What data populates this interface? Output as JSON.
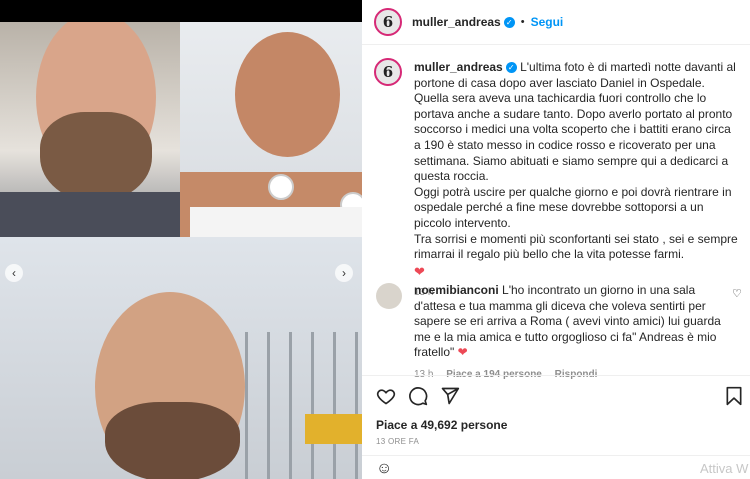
{
  "post": {
    "username": "muller_andreas",
    "follow_label": "Segui",
    "dot": "•",
    "caption_lines": [
      "L'ultima foto è di martedì notte davanti al portone di casa dopo aver lasciato Daniel in Ospedale. Quella sera aveva una tachicardia fuori controllo che lo portava anche a sudare tanto. Dopo averlo portato al pronto soccorso i medici una volta scoperto che i battiti erano circa a 190 è stato messo in codice rosso e ricoverato per una settimana. Siamo abituati e siamo sempre qui a dedicarci a questa roccia.",
      "Oggi potrà uscire per qualche giorno e poi dovrà rientrare in ospedale perché a fine mese dovrebbe sottoporsi a un piccolo intervento.",
      "Tra sorrisi e momenti più sconfortanti sei stato , sei e sempre rimarrai il regalo più bello che la vita potesse farmi."
    ],
    "caption_time": "13 h",
    "likes": "Piace a 49,692 persone",
    "posted_ago": "13 ORE FA"
  },
  "comment": {
    "username": "noemibianconi",
    "text": "L'ho incontrato un giorno in una sala d'attesa e tua mamma gli diceva che voleva sentirti per sapere se eri arriva a Roma ( avevi vinto amici) lui guarda me e la mia amica e tutto orgoglioso ci fa\" Andreas è mio fratello\"",
    "time": "13 h",
    "likes": "Piace a 194 persone",
    "reply_label": "Rispondi"
  },
  "icons": {
    "heart_emoji": "red-heart",
    "like": "heart-outline-icon",
    "comment": "comment-icon",
    "share": "paper-plane-icon",
    "save": "bookmark-icon"
  },
  "photo": {
    "avatar_letter": "6",
    "carousel_dots": 8,
    "active_dot": 7
  },
  "system": {
    "watermark": "Attiva W"
  },
  "colors": {
    "link": "#0095f6",
    "heart": "#ed4956",
    "muted": "#8e8e8e",
    "text": "#262626",
    "story_ring": "#d62976"
  }
}
